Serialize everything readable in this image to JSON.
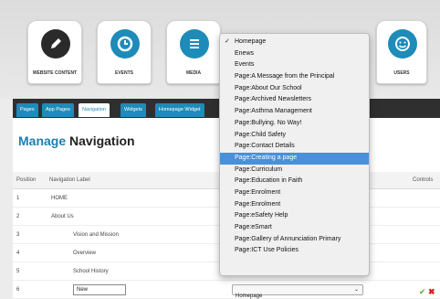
{
  "tiles": [
    {
      "label": "WEBSITE CONTENT",
      "icon": "pencil-icon"
    },
    {
      "label": "EVENTS",
      "icon": "clock-icon"
    },
    {
      "label": "MEDIA",
      "icon": "list-icon"
    },
    {
      "label": "USERS",
      "icon": "smiley-icon"
    }
  ],
  "tabs": [
    "Pages",
    "App Pages",
    "Navigation",
    "Widgets",
    "Homepage Widget"
  ],
  "active_tab": "Navigation",
  "heading": {
    "part1": "Manage",
    "part2": "Navigation"
  },
  "table": {
    "headers": {
      "position": "Position",
      "label": "Navigation Label",
      "controls": "Controls"
    },
    "rows": [
      {
        "pos": "1",
        "label": "HOME"
      },
      {
        "pos": "2",
        "label": "About Us"
      },
      {
        "pos": "3",
        "label": "Vision and Mission"
      },
      {
        "pos": "4",
        "label": "Overview"
      },
      {
        "pos": "5",
        "label": "School History"
      },
      {
        "pos": "6",
        "label": "New"
      }
    ]
  },
  "select_value": "Homepage",
  "dropdown": {
    "options": [
      "Homepage",
      "Enews",
      "Events",
      "Page:A Message from the Principal",
      "Page:About Our School",
      "Page:Archived Newsletters",
      "Page:Asthma Management",
      "Page:Bullying. No Way!",
      "Page:Child Safety",
      "Page:Contact Details",
      "Page:Creating a page",
      "Page:Curriculum",
      "Page:Education in Faith",
      "Page:Enrolment",
      "Page:Enrolment",
      "Page:eSafety Help",
      "Page:eSmart",
      "Page:Gallery of Annunciation Primary",
      "Page:ICT Use Policies"
    ],
    "checked_index": 0,
    "highlight_index": 10
  },
  "colors": {
    "accent": "#1e8bb8",
    "tabs_bg": "#2f2f2f",
    "highlight": "#4a90d9",
    "ok": "#5aa832",
    "delete": "#cc2222"
  }
}
